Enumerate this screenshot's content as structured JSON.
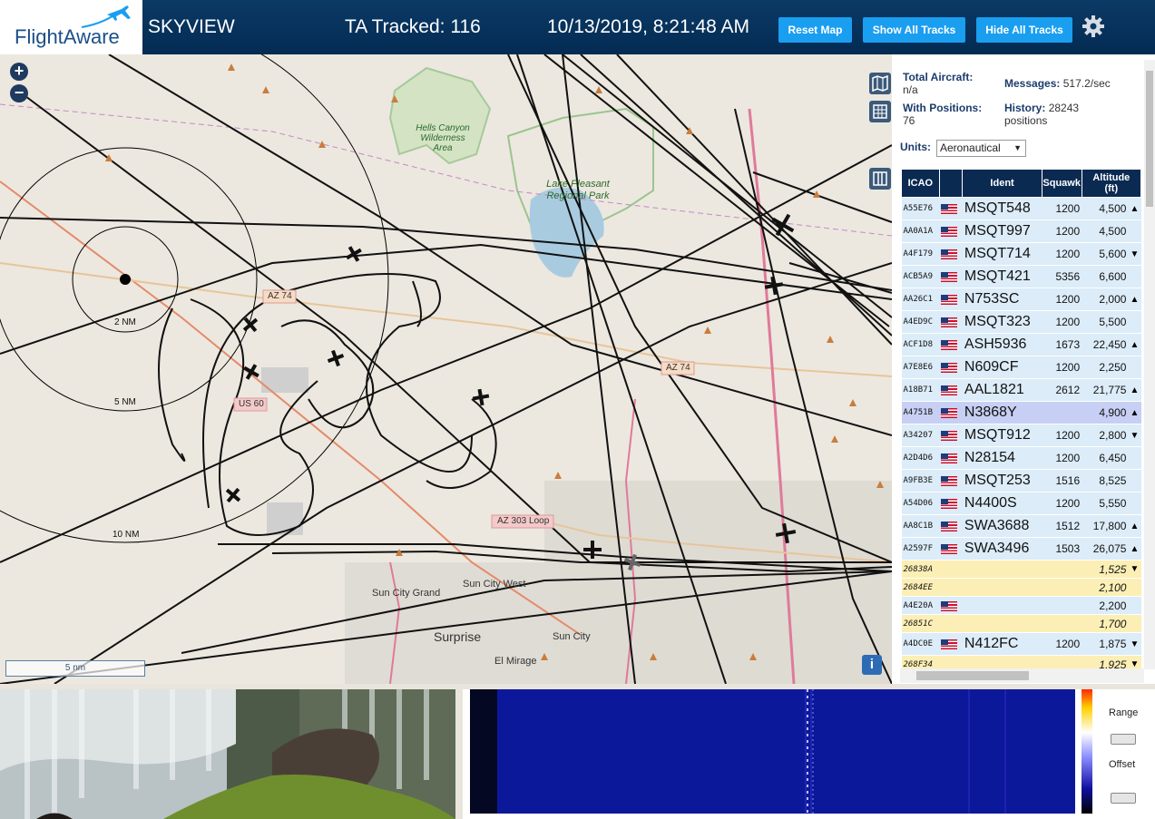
{
  "header": {
    "logo_text": "FlightAware",
    "title": "SKYVIEW",
    "tracked": "TA Tracked: 116",
    "datetime": "10/13/2019, 8:21:48 AM",
    "buttons": [
      "Reset Map",
      "Show All Tracks",
      "Hide All Tracks"
    ],
    "settings_icon": "gear-icon"
  },
  "map": {
    "zoom_in": "+",
    "zoom_out": "−",
    "scale_label": "5 nm",
    "info_label": "i",
    "labels": {
      "hells_canyon": "Hells Canyon Wilderness Area",
      "lake": "Lake Pleasant Regional Park",
      "az74_a": "AZ 74",
      "az74_b": "AZ 74",
      "us60": "US 60",
      "az303": "AZ 303 Loop",
      "sun_city_grand": "Sun City Grand",
      "sun_city_west": "Sun City West",
      "surprise": "Surprise",
      "sun_city": "Sun City",
      "el_mirage": "El Mirage",
      "ring_2": "2 NM",
      "ring_5": "5 NM",
      "ring_10": "10 NM"
    },
    "controls": [
      "map-layers-icon",
      "grid-icon",
      "columns-icon"
    ]
  },
  "panel": {
    "total_aircraft_label": "Total Aircraft:",
    "total_aircraft_value": "n/a",
    "messages_label": "Messages:",
    "messages_value": "517.2/sec",
    "with_positions_label": "With Positions:",
    "with_positions_value": "76",
    "history_label": "History:",
    "history_value": "28243",
    "history_unit": "positions",
    "units_label": "Units:",
    "units_value": "Aeronautical",
    "columns": {
      "icao": "ICAO",
      "ident": "Ident",
      "squawk": "Squawk",
      "altitude": "Altitude",
      "altitude_unit": "(ft)"
    },
    "rows": [
      {
        "icao": "A55E76",
        "flag": true,
        "ident": "MSQT548",
        "squawk": "1200",
        "alt": "4,500",
        "trend": "▲",
        "style": "plain"
      },
      {
        "icao": "AA0A1A",
        "flag": true,
        "ident": "MSQT997",
        "squawk": "1200",
        "alt": "4,500",
        "trend": "",
        "style": "plain"
      },
      {
        "icao": "A4F179",
        "flag": true,
        "ident": "MSQT714",
        "squawk": "1200",
        "alt": "5,600",
        "trend": "▼",
        "style": "plain"
      },
      {
        "icao": "ACB5A9",
        "flag": true,
        "ident": "MSQT421",
        "squawk": "5356",
        "alt": "6,600",
        "trend": "",
        "style": "plain"
      },
      {
        "icao": "AA26C1",
        "flag": true,
        "ident": "N753SC",
        "squawk": "1200",
        "alt": "2,000",
        "trend": "▲",
        "style": "plain"
      },
      {
        "icao": "A4ED9C",
        "flag": true,
        "ident": "MSQT323",
        "squawk": "1200",
        "alt": "5,500",
        "trend": "",
        "style": "plain"
      },
      {
        "icao": "ACF1D8",
        "flag": true,
        "ident": "ASH5936",
        "squawk": "1673",
        "alt": "22,450",
        "trend": "▲",
        "style": "plain"
      },
      {
        "icao": "A7E8E6",
        "flag": true,
        "ident": "N609CF",
        "squawk": "1200",
        "alt": "2,250",
        "trend": "",
        "style": "plain"
      },
      {
        "icao": "A18B71",
        "flag": true,
        "ident": "AAL1821",
        "squawk": "2612",
        "alt": "21,775",
        "trend": "▲",
        "style": "plain"
      },
      {
        "icao": "A4751B",
        "flag": true,
        "ident": "N3868Y",
        "squawk": "",
        "alt": "4,900",
        "trend": "▲",
        "style": "sel"
      },
      {
        "icao": "A34207",
        "flag": true,
        "ident": "MSQT912",
        "squawk": "1200",
        "alt": "2,800",
        "trend": "▼",
        "style": "plain"
      },
      {
        "icao": "A2D4D6",
        "flag": true,
        "ident": "N28154",
        "squawk": "1200",
        "alt": "6,450",
        "trend": "",
        "style": "plain"
      },
      {
        "icao": "A9FB3E",
        "flag": true,
        "ident": "MSQT253",
        "squawk": "1516",
        "alt": "8,525",
        "trend": "",
        "style": "plain"
      },
      {
        "icao": "A54D06",
        "flag": true,
        "ident": "N4400S",
        "squawk": "1200",
        "alt": "5,550",
        "trend": "",
        "style": "plain"
      },
      {
        "icao": "AA8C1B",
        "flag": true,
        "ident": "SWA3688",
        "squawk": "1512",
        "alt": "17,800",
        "trend": "▲",
        "style": "plain"
      },
      {
        "icao": "A2597F",
        "flag": true,
        "ident": "SWA3496",
        "squawk": "1503",
        "alt": "26,075",
        "trend": "▲",
        "style": "plain"
      },
      {
        "icao": "26838A",
        "flag": false,
        "ident": "",
        "squawk": "",
        "alt": "1,525",
        "trend": "▼",
        "style": "yellow"
      },
      {
        "icao": "2684EE",
        "flag": false,
        "ident": "",
        "squawk": "",
        "alt": "2,100",
        "trend": "",
        "style": "yellow"
      },
      {
        "icao": "A4E20A",
        "flag": true,
        "ident": "",
        "squawk": "",
        "alt": "2,200",
        "trend": "",
        "style": "plain"
      },
      {
        "icao": "26851C",
        "flag": false,
        "ident": "",
        "squawk": "",
        "alt": "1,700",
        "trend": "",
        "style": "yellow"
      },
      {
        "icao": "A4DC0E",
        "flag": true,
        "ident": "N412FC",
        "squawk": "1200",
        "alt": "1,875",
        "trend": "▼",
        "style": "plain"
      },
      {
        "icao": "268F34",
        "flag": false,
        "ident": "",
        "squawk": "",
        "alt": "1,925",
        "trend": "▼",
        "style": "yellow"
      }
    ]
  },
  "spectrum": {
    "range_label": "Range",
    "offset_label": "Offset"
  }
}
